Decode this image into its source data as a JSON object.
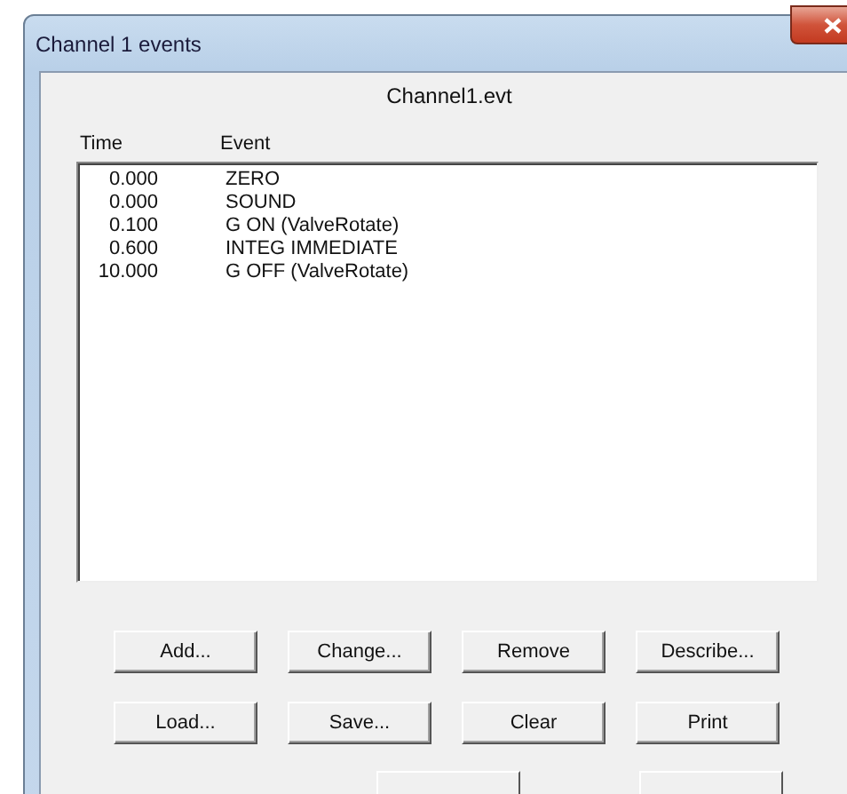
{
  "window": {
    "title": "Channel 1 events"
  },
  "file_name": "Channel1.evt",
  "columns": [
    "Time",
    "Event"
  ],
  "rows": [
    {
      "time": "0.000",
      "event": "ZERO"
    },
    {
      "time": "0.000",
      "event": "SOUND"
    },
    {
      "time": "0.100",
      "event": "G ON (ValveRotate)"
    },
    {
      "time": "0.600",
      "event": "INTEG IMMEDIATE"
    },
    {
      "time": "10.000",
      "event": "G OFF (ValveRotate)"
    }
  ],
  "button_rows": [
    [
      "Add...",
      "Change...",
      "Remove",
      "Describe..."
    ],
    [
      "Load...",
      "Save...",
      "Clear",
      "Print"
    ]
  ]
}
